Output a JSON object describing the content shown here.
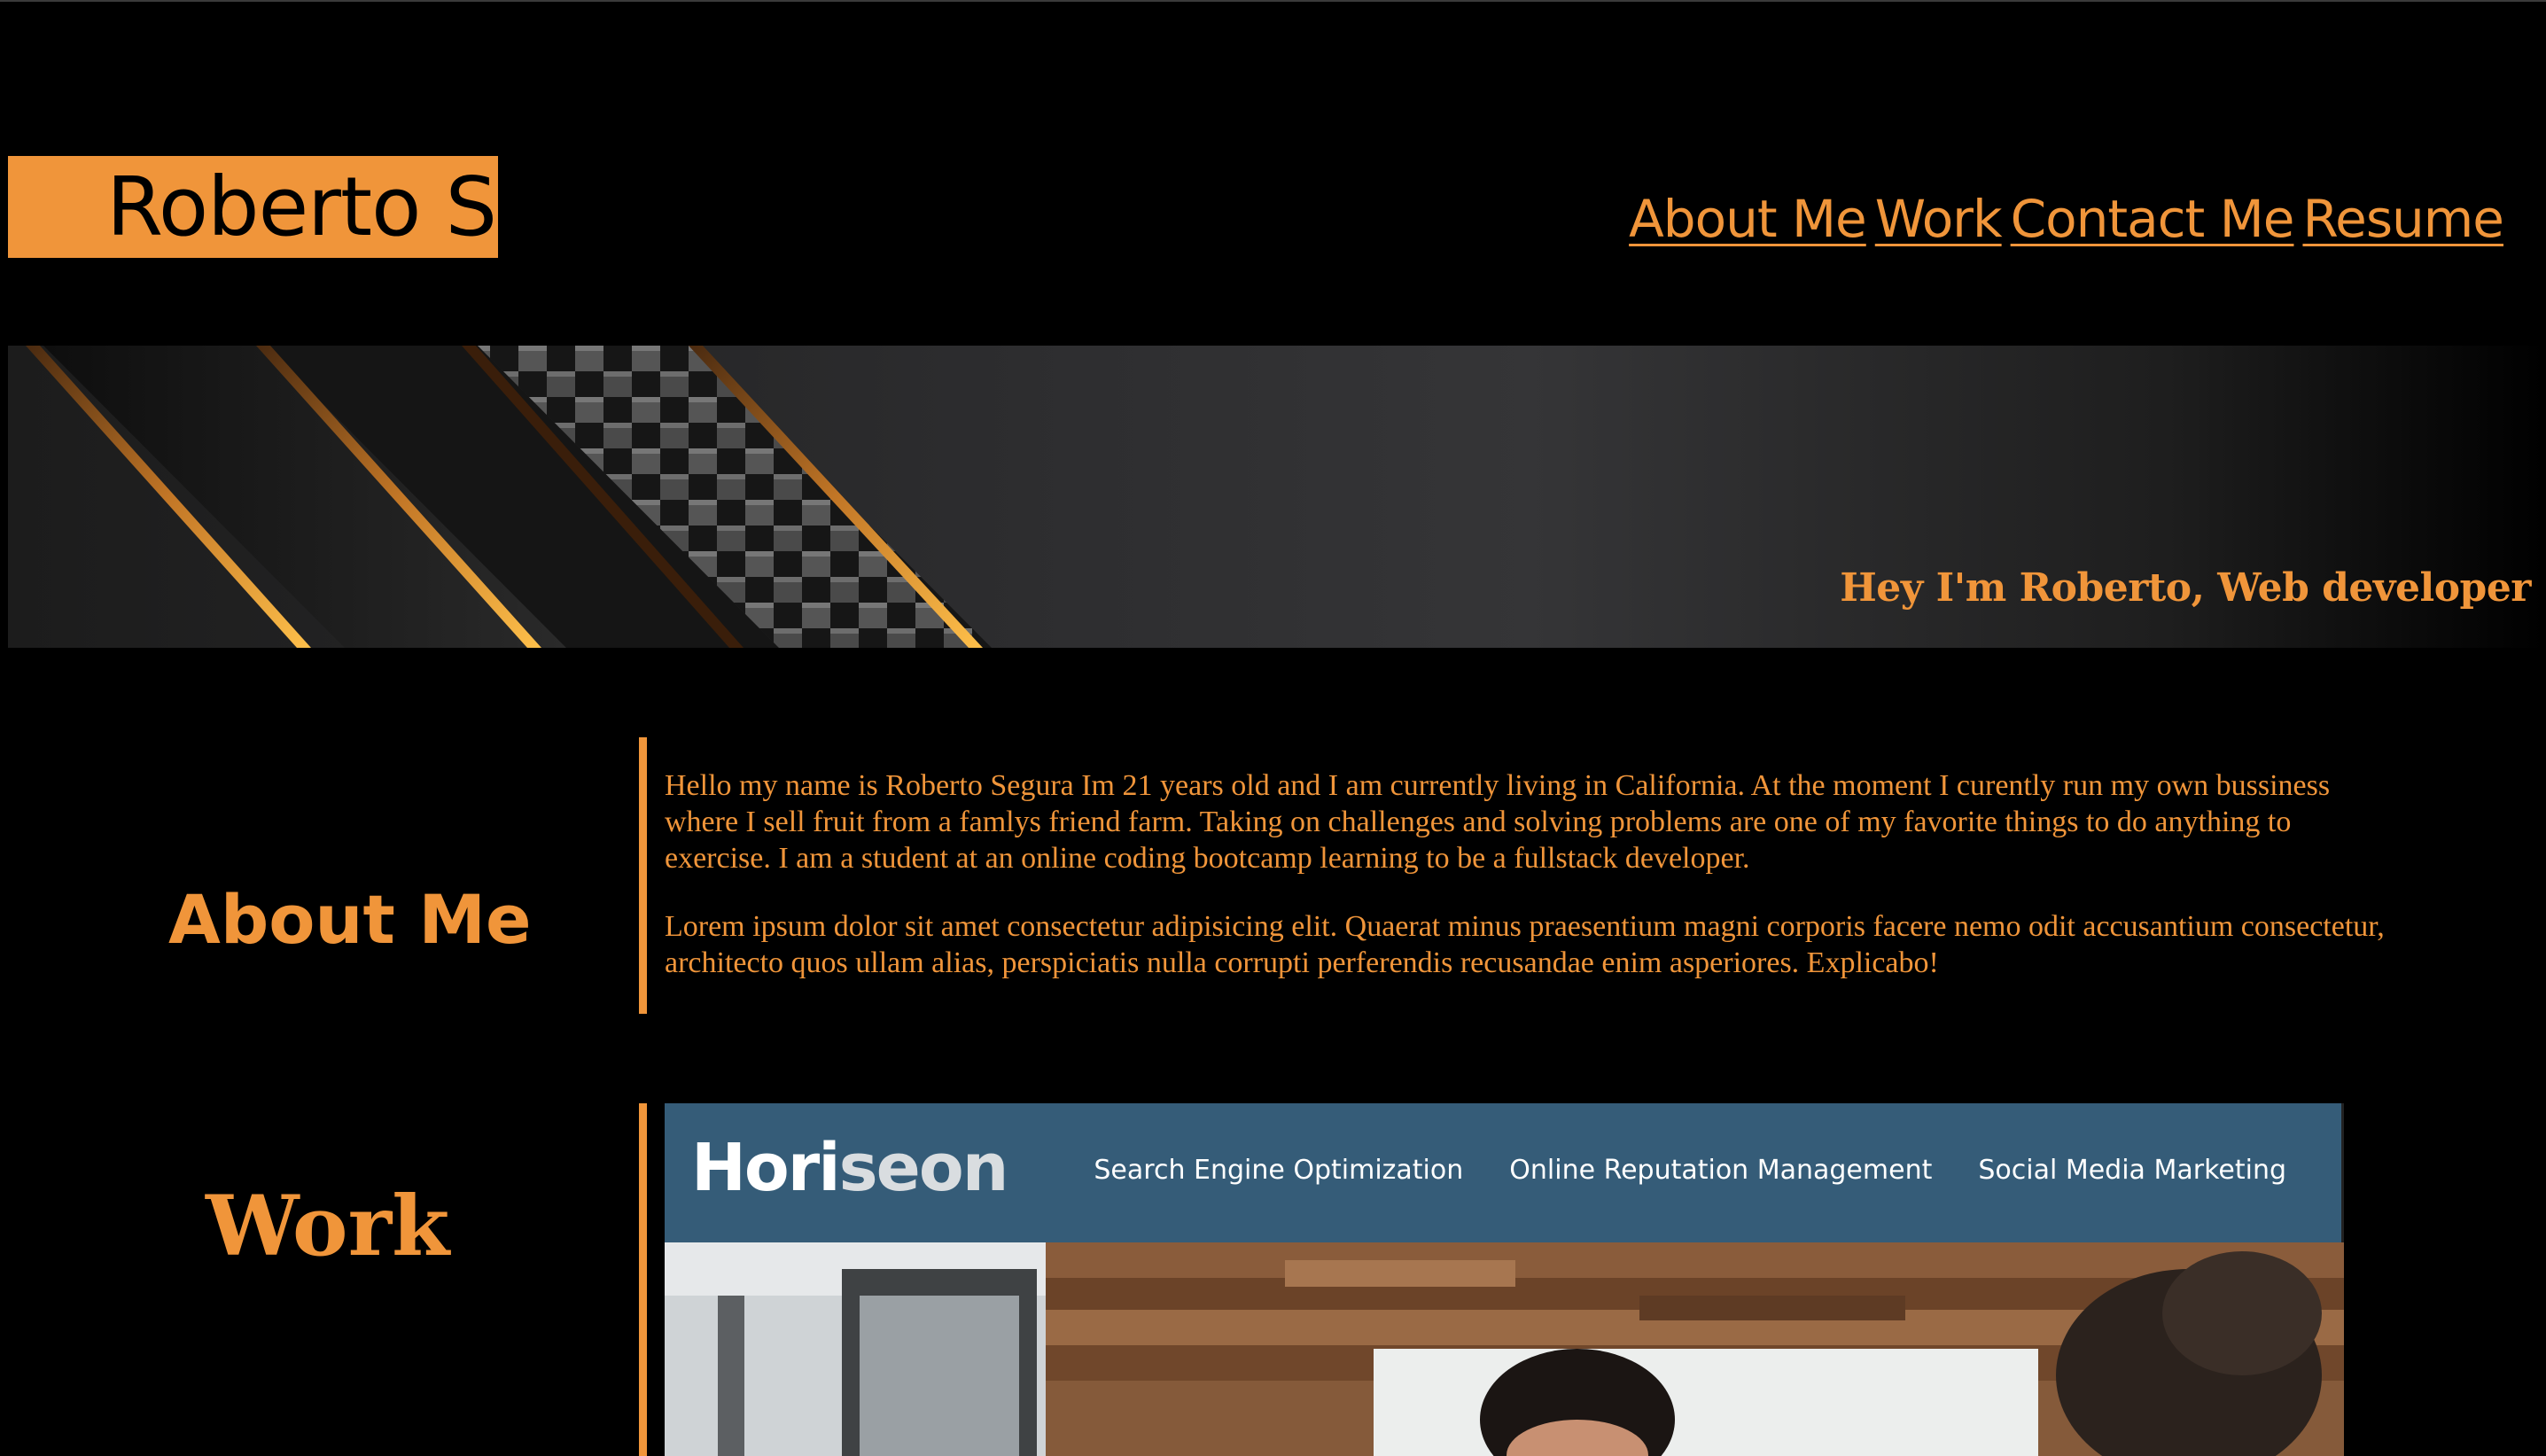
{
  "header": {
    "brand": "Roberto S",
    "nav": [
      "About Me",
      "Work",
      "Contact Me",
      "Resume"
    ]
  },
  "hero": {
    "tagline": "Hey I'm Roberto, Web developer"
  },
  "about": {
    "title": "About Me",
    "paragraphs": [
      "Hello my name is Roberto Segura Im 21 years old and I am currently living in California. At the moment I curently run my own bussiness where I sell fruit from a famlys friend farm. Taking on challenges and solving problems are one of my favorite things to do anything to exercise. I am a student at an online coding bootcamp learning to be a fullstack developer.",
      "Lorem ipsum dolor sit amet consectetur adipisicing elit. Quaerat minus praesentium magni corporis facere nemo odit accusantium consectetur, architecto quos ullam alias, perspiciatis nulla corrupti perferendis recusandae enim asperiores. Explicabo!"
    ]
  },
  "work": {
    "title": "Work",
    "project": {
      "logo_main": "Hori",
      "logo_light": "seon",
      "nav": [
        "Search Engine Optimization",
        "Online Reputation Management",
        "Social Media Marketing"
      ]
    }
  },
  "colors": {
    "accent": "#f0953a",
    "background": "#000000",
    "project_header": "#355c78"
  }
}
